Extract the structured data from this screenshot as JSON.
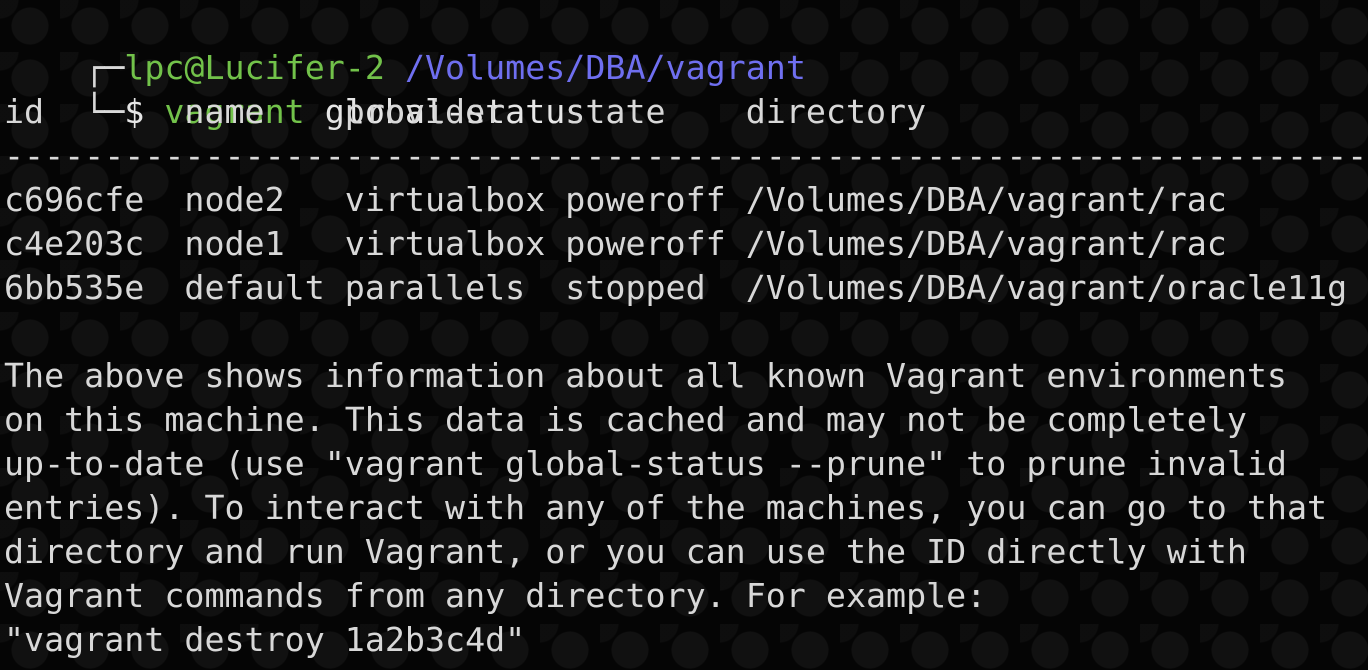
{
  "prompt": {
    "corner_top": "┌─",
    "corner_bottom": "└─",
    "user_host": "lpc@Lucifer-2",
    "path": "/Volumes/DBA/vagrant",
    "symbol": "$",
    "command": "vagrant",
    "args": "global-status"
  },
  "table": {
    "header": "id       name    provider   state    directory",
    "separator": "--------------------------------------------------------------------",
    "rows": [
      "c696cfe  node2   virtualbox poweroff /Volumes/DBA/vagrant/rac",
      "c4e203c  node1   virtualbox poweroff /Volumes/DBA/vagrant/rac",
      "6bb535e  default parallels  stopped  /Volumes/DBA/vagrant/oracle11g"
    ]
  },
  "message": [
    "The above shows information about all known Vagrant environments",
    "on this machine. This data is cached and may not be completely",
    "up-to-date (use \"vagrant global-status --prune\" to prune invalid",
    "entries). To interact with any of the machines, you can go to that",
    "directory and run Vagrant, or you can use the ID directly with",
    "Vagrant commands from any directory. For example:",
    "\"vagrant destroy 1a2b3c4d\""
  ],
  "colors": {
    "background": "#050505",
    "prompt_user": "#72c24a",
    "prompt_path": "#6f6ff0",
    "text": "#d8d8d8"
  }
}
